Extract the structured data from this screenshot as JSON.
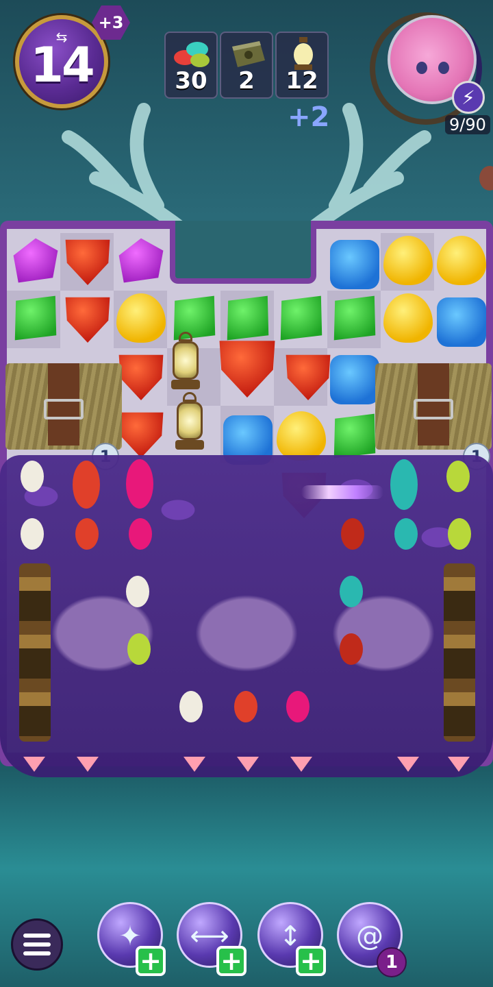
{
  "hud": {
    "moves_left": "14",
    "moves_bonus": "+3",
    "goals": [
      {
        "icon": "jelly-beans-icon",
        "count": "30"
      },
      {
        "icon": "spellbook-icon",
        "count": "2"
      },
      {
        "icon": "lantern-icon",
        "count": "12"
      }
    ],
    "goal_bonus": "+2",
    "energy": "9/90",
    "energy_icon": "lightning-icon",
    "avatar_icon": "pink-cat-pet-icon"
  },
  "board": {
    "obstacle_badge_left": "1",
    "obstacle_badge_right": "1"
  },
  "boosters": [
    {
      "icon": "star-burst-booster-icon",
      "action": "+"
    },
    {
      "icon": "horizontal-lightning-booster-icon",
      "action": "+"
    },
    {
      "icon": "vertical-lightning-booster-icon",
      "action": "+"
    },
    {
      "icon": "swirl-booster-icon",
      "count": "1"
    }
  ],
  "colors": {
    "board_frame": "#7a3fa0",
    "add_button": "#27c04a",
    "goal_bonus_text": "#8aa6ff"
  }
}
